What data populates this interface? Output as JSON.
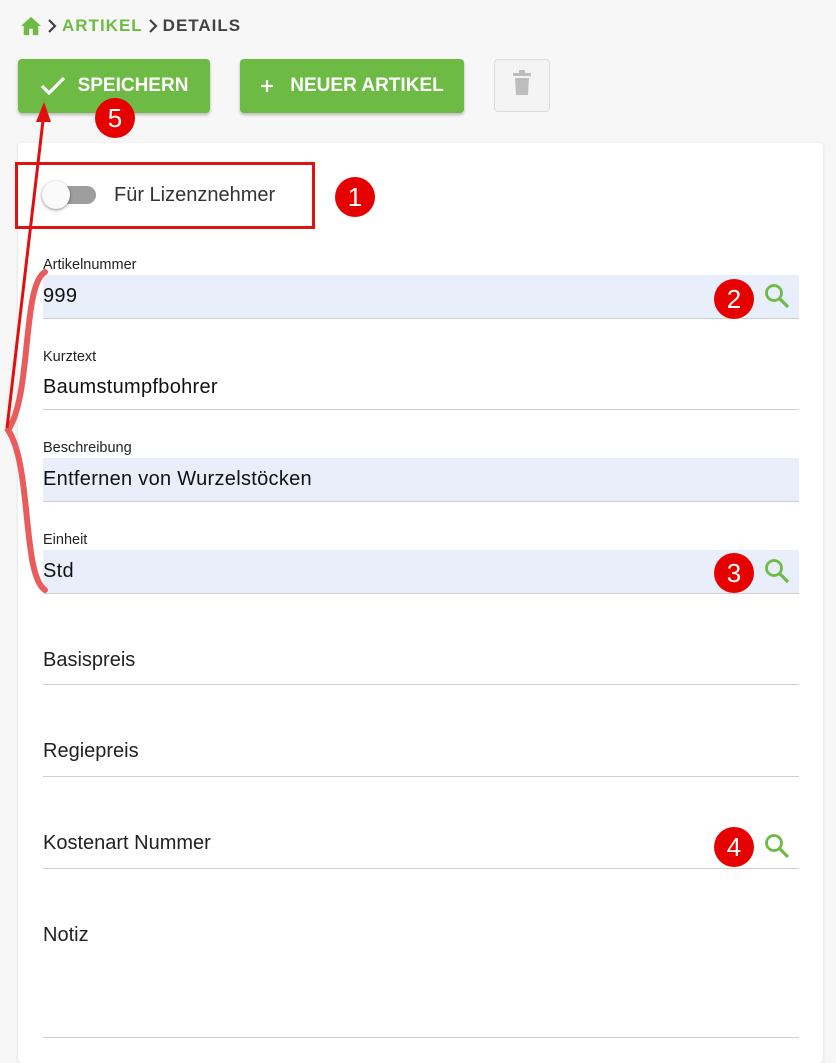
{
  "breadcrumb": {
    "home_icon": "home-icon",
    "items": [
      "ARTIKEL",
      "DETAILS"
    ]
  },
  "toolbar": {
    "save_label": "SPEICHERN",
    "new_label": "NEUER ARTIKEL",
    "delete_icon": "trash-icon"
  },
  "form": {
    "license_toggle_label": "Für Lizenznehmer",
    "license_toggle_on": false,
    "fields": [
      {
        "label": "Artikelnummer",
        "value": "999",
        "has_search": true
      },
      {
        "label": "Kurztext",
        "value": "Baumstumpfbohrer",
        "has_search": false
      },
      {
        "label": "Beschreibung",
        "value": "Entfernen von Wurzelstöcken",
        "has_search": false
      },
      {
        "label": "Einheit",
        "value": "Std",
        "has_search": true
      },
      {
        "label": "Basispreis",
        "value": "",
        "has_search": false
      },
      {
        "label": "Regiepreis",
        "value": "",
        "has_search": false
      },
      {
        "label": "Kostenart Nummer",
        "value": "",
        "has_search": true
      },
      {
        "label": "Notiz",
        "value": "",
        "has_search": false
      }
    ]
  },
  "annotations": {
    "markers": [
      "1",
      "2",
      "3",
      "4",
      "5"
    ],
    "color": "#e60000"
  },
  "colors": {
    "accent": "#6dbb45",
    "filled_field": "#e8effb"
  }
}
